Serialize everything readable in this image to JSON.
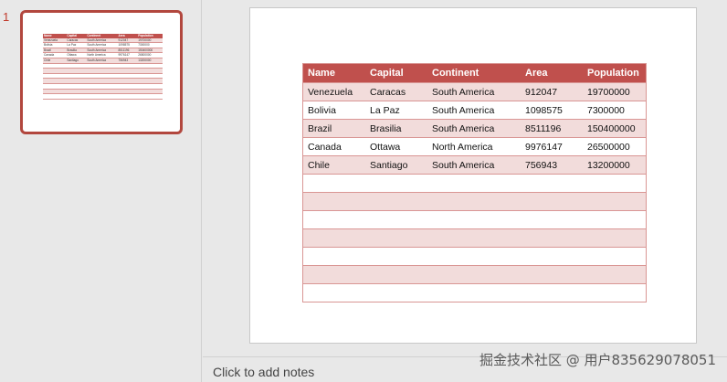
{
  "thumbnail": {
    "slide_number": "1"
  },
  "table": {
    "headers": [
      "Name",
      "Capital",
      "Continent",
      "Area",
      "Population"
    ],
    "rows": [
      [
        "Venezuela",
        "Caracas",
        "South America",
        "912047",
        "19700000"
      ],
      [
        "Bolivia",
        "La Paz",
        "South America",
        "1098575",
        "7300000"
      ],
      [
        "Brazil",
        "Brasilia",
        "South America",
        "8511196",
        "150400000"
      ],
      [
        "Canada",
        "Ottawa",
        "North America",
        "9976147",
        "26500000"
      ],
      [
        "Chile",
        "Santiago",
        "South America",
        "756943",
        "13200000"
      ]
    ],
    "empty_rows": 7
  },
  "notes": {
    "placeholder": "Click to add notes"
  },
  "watermark": "掘金技术社区 @ 用户835629078051",
  "colors": {
    "header": "#c0504d",
    "band": "#f2dcdb",
    "border": "#d99694",
    "thumb_border": "#b2473e"
  }
}
